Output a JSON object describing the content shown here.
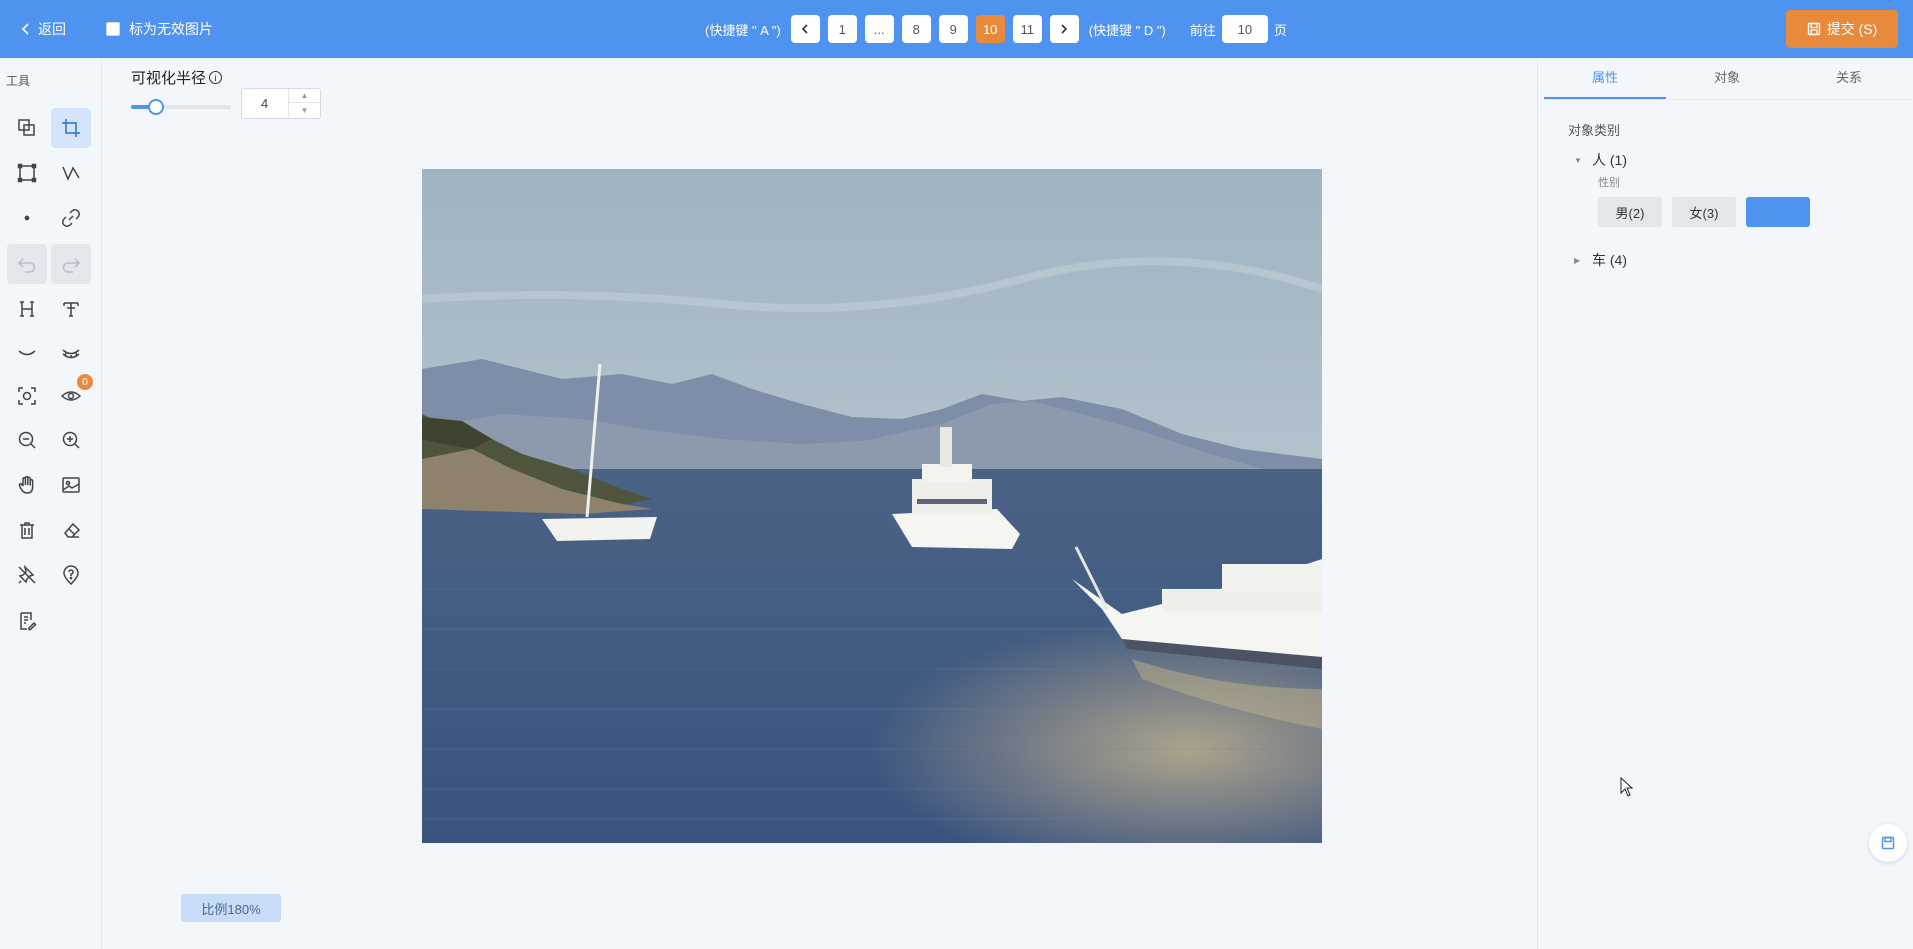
{
  "header": {
    "back_label": "返回",
    "invalid_label": "标为无效图片",
    "prev_hint": "(快捷键 \" A \")",
    "next_hint": "(快捷键 \" D \")",
    "pages": [
      "1",
      "...",
      "8",
      "9",
      "10",
      "11"
    ],
    "current_page": "10",
    "goto_label": "前往",
    "goto_value": "10",
    "page_suffix": "页",
    "submit_label": "提交 (S)"
  },
  "toolbar": {
    "title": "工具",
    "badge_count": "0",
    "tools": [
      "copy-icon",
      "crop-icon",
      "rectangle-icon",
      "polyline-icon",
      "point-icon",
      "link-icon",
      "undo-icon",
      "redo-icon",
      "h-align-icon",
      "text-format-icon",
      "eye-closed-icon",
      "eye-lashes-icon",
      "focus-icon",
      "eye-icon",
      "zoom-out-icon",
      "zoom-in-icon",
      "hand-icon",
      "image-icon",
      "trash-icon",
      "eraser-icon",
      "pin-off-icon",
      "location-help-icon",
      "notes-icon"
    ]
  },
  "canvas": {
    "radius_label": "可视化半径",
    "radius_value": "4",
    "slider_fraction": 0.25,
    "scale_label": "比例180%"
  },
  "right_panel": {
    "tabs": [
      "属性",
      "对象",
      "关系"
    ],
    "active_tab": "属性",
    "category_title": "对象类别",
    "nodes": [
      {
        "label": "人 (1)",
        "expanded": true,
        "attr_label": "性别",
        "options": [
          "男(2)",
          "女(3)",
          ""
        ]
      },
      {
        "label": "车 (4)",
        "expanded": false
      }
    ]
  },
  "colors": {
    "primary": "#4f93f0",
    "accent": "#e88a3c",
    "background": "#f3f6fa"
  }
}
